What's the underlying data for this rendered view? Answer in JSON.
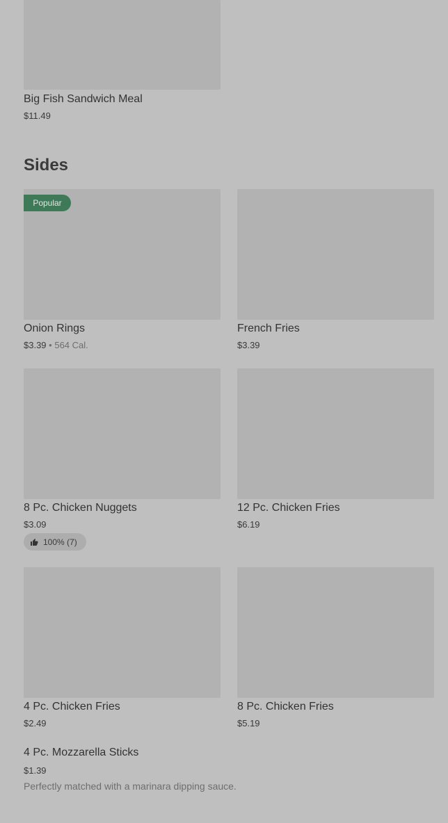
{
  "previous_item": {
    "title": "Big Fish Sandwich Meal",
    "price": "$11.49"
  },
  "section": {
    "title": "Sides"
  },
  "items": [
    {
      "title": "Onion Rings",
      "price": "$3.39",
      "calories": "564 Cal.",
      "badge": "Popular"
    },
    {
      "title": "French Fries",
      "price": "$3.39"
    },
    {
      "title": "8 Pc. Chicken Nuggets",
      "price": "$3.09",
      "rating": "100% (7)"
    },
    {
      "title": "12 Pc. Chicken Fries",
      "price": "$6.19"
    },
    {
      "title": "4 Pc. Chicken Fries",
      "price": "$2.49"
    },
    {
      "title": "8 Pc. Chicken Fries",
      "price": "$5.19"
    },
    {
      "title": "4 Pc. Mozzarella Sticks",
      "price": "$1.39",
      "description": "Perfectly matched with a marinara dipping sauce."
    }
  ],
  "icons": {
    "rating": "thumbs-up-icon"
  },
  "colors": {
    "badge_bg": "#3e7a57",
    "background": "#bfbfbf",
    "image_placeholder": "#b2b2b2"
  }
}
